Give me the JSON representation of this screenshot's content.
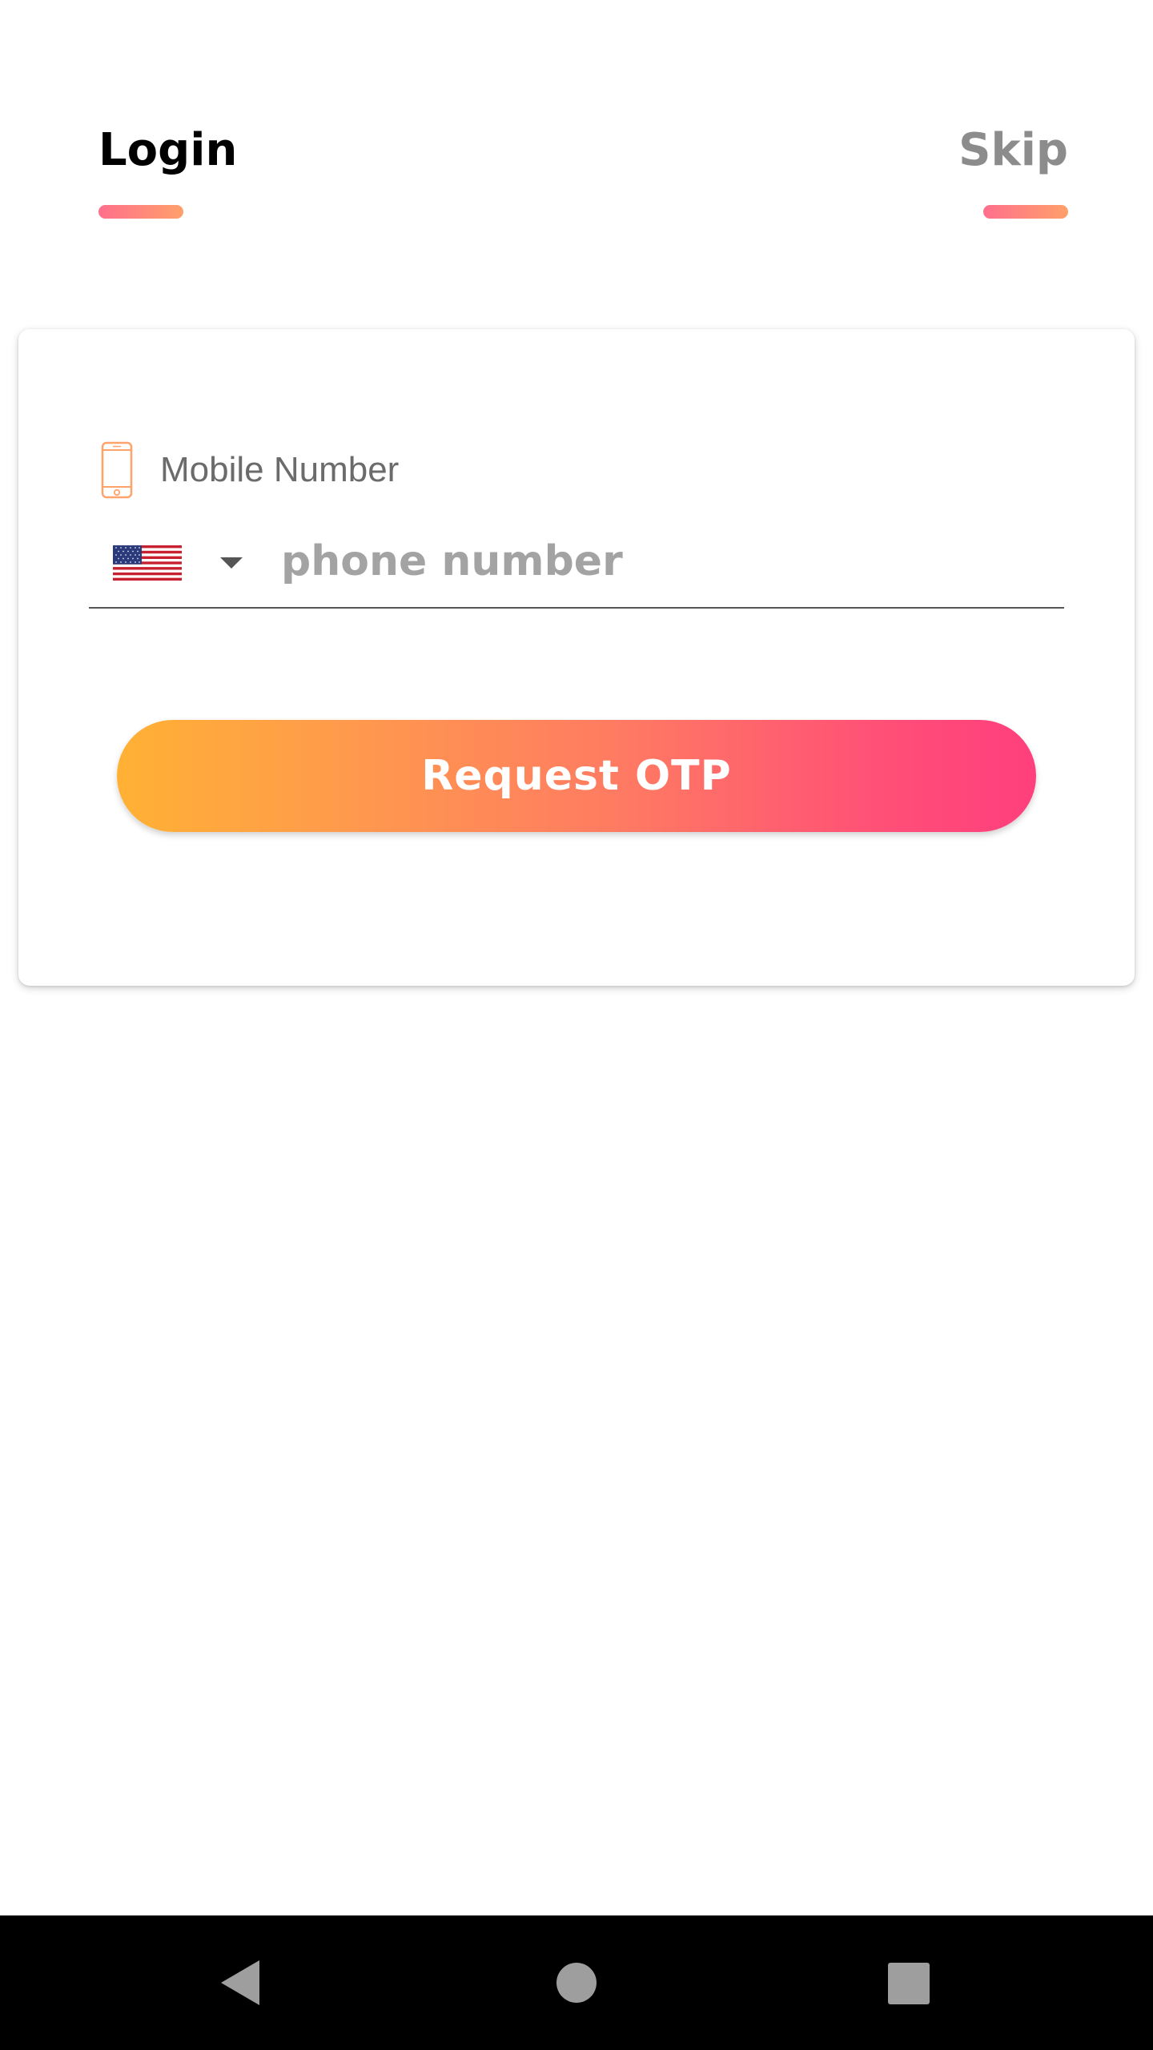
{
  "header": {
    "login_tab": "Login",
    "skip_tab": "Skip"
  },
  "form": {
    "field_label": "Mobile Number",
    "field_icon": "mobile-phone-icon",
    "country": {
      "flag": "us-flag-icon",
      "dropdown_icon": "caret-down-icon"
    },
    "phone": {
      "value": "",
      "placeholder": "phone number"
    },
    "submit_label": "Request OTP"
  },
  "nav_bar": {
    "back_icon": "back-triangle-icon",
    "home_icon": "home-circle-icon",
    "recents_icon": "recents-square-icon"
  },
  "colors": {
    "accent_start": "#ffb134",
    "accent_end": "#ff3f7d",
    "tab_underline_start": "#ff6f8c",
    "tab_underline_end": "#ffa06a",
    "icon_orange": "#ffa36b"
  }
}
